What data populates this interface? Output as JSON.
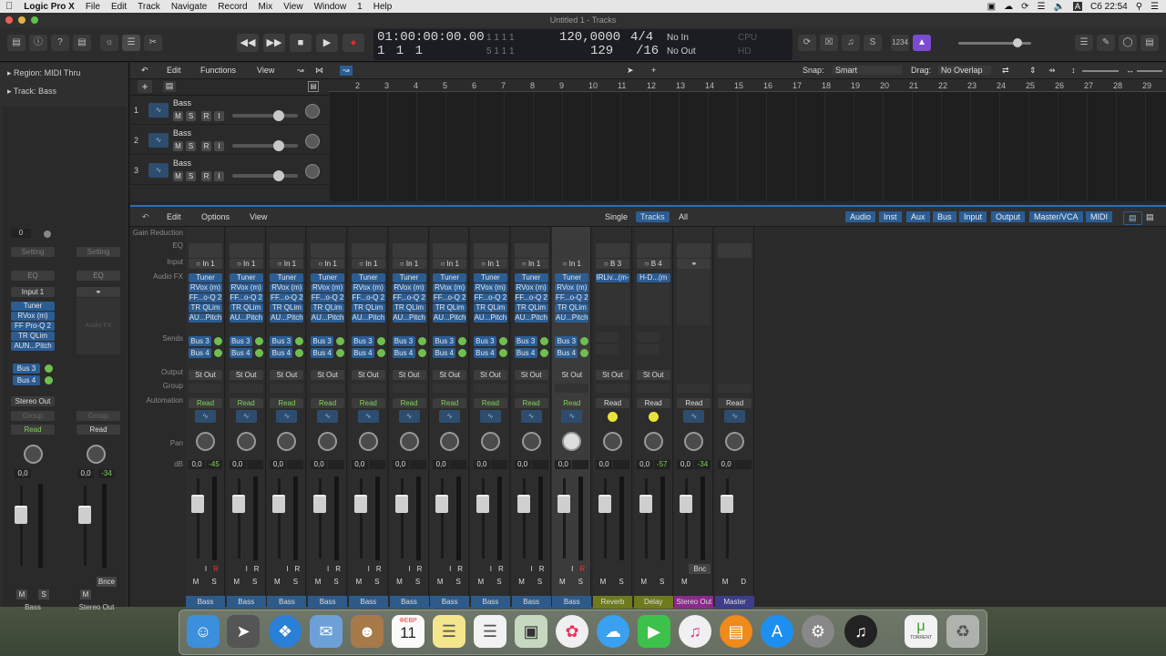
{
  "menubar": {
    "apple": "",
    "app": "Logic Pro X",
    "items": [
      "File",
      "Edit",
      "Track",
      "Navigate",
      "Record",
      "Mix",
      "View",
      "Window",
      "1",
      "Help"
    ],
    "time": "Сб 22:54",
    "input_lang": "A"
  },
  "window": {
    "title": "Untitled 1 - Tracks"
  },
  "lcd": {
    "time": "01:00:00:00.00",
    "bars": "1 1 1 1",
    "bars_small": "1 1 1 1",
    "bars_sub": "1 1 1",
    "bars_sub2": "5 1 1 1",
    "tempo": "120,0000",
    "tempo_sub": "129",
    "sig": "4/4",
    "div": "/16",
    "in": "No In",
    "out": "No Out"
  },
  "inspector": {
    "region_label": "Region:",
    "region_value": "MIDI Thru",
    "track_label": "Track:",
    "track_value": "Bass",
    "setting": "Setting",
    "eq": "EQ",
    "input": "Input 1",
    "audio_fx": "Audio FX",
    "plugins": [
      "Tuner",
      "RVox (m)",
      "FF Pro-Q 2",
      "TR QLim",
      "AUN...Pitch"
    ],
    "sends": [
      "Bus 3",
      "Bus 4"
    ],
    "output": "Stereo Out",
    "group": "Group",
    "read": "Read",
    "vol1": "0,0",
    "vol2": "0,0",
    "peak2": "-34",
    "bnce": "Bnce",
    "m": "M",
    "s": "S",
    "name1": "Bass",
    "name2": "Stereo Out",
    "top_value": "0"
  },
  "tracks_header": {
    "edit": "Edit",
    "functions": "Functions",
    "view": "View",
    "snap_label": "Snap:",
    "snap_value": "Smart",
    "drag_label": "Drag:",
    "drag_value": "No Overlap"
  },
  "tracks": [
    {
      "num": "1",
      "name": "Bass"
    },
    {
      "num": "2",
      "name": "Bass"
    },
    {
      "num": "3",
      "name": "Bass"
    }
  ],
  "track_buttons": {
    "m": "M",
    "s": "S",
    "r": "R",
    "i": "I"
  },
  "ruler": [
    "2",
    "3",
    "4",
    "5",
    "6",
    "7",
    "8",
    "9",
    "10",
    "11",
    "12",
    "13",
    "14",
    "15",
    "16",
    "17",
    "18",
    "19",
    "20",
    "21",
    "22",
    "23",
    "24",
    "25",
    "26",
    "27",
    "28",
    "29"
  ],
  "mixer_header": {
    "edit": "Edit",
    "options": "Options",
    "view": "View",
    "views": [
      "Single",
      "Tracks",
      "All"
    ],
    "filters": [
      "Audio",
      "Inst",
      "Aux",
      "Bus",
      "Input",
      "Output",
      "Master/VCA",
      "MIDI"
    ]
  },
  "mixer_rows": {
    "gain": "Gain Reduction",
    "eq": "EQ",
    "input": "Input",
    "audio_fx": "Audio FX",
    "sends": "Sends",
    "output": "Output",
    "group": "Group",
    "automation": "Automation",
    "pan": "Pan",
    "db": "dB"
  },
  "mixer_strips": [
    {
      "name": "Bass",
      "input": "In 1",
      "fx": [
        "Tuner",
        "RVox (m)",
        "FF...o-Q 2",
        "TR QLim",
        "AU...Pitch"
      ],
      "sends": [
        "Bus 3",
        "Bus 4"
      ],
      "out": "St Out",
      "auto": "Read",
      "vol": "0,0",
      "peak": "-45",
      "color": "#2e5a8a",
      "rec": "true"
    },
    {
      "name": "Bass",
      "input": "In 1",
      "fx": [
        "Tuner",
        "RVox (m)",
        "FF...o-Q 2",
        "TR QLim",
        "AU...Pitch"
      ],
      "sends": [
        "Bus 3",
        "Bus 4"
      ],
      "out": "St Out",
      "auto": "Read",
      "vol": "0,0",
      "peak": "",
      "color": "#2e5a8a",
      "rec": "true"
    },
    {
      "name": "Bass",
      "input": "In 1",
      "fx": [
        "Tuner",
        "RVox (m)",
        "FF...o-Q 2",
        "TR QLim",
        "AU...Pitch"
      ],
      "sends": [
        "Bus 3",
        "Bus 4"
      ],
      "out": "St Out",
      "auto": "Read",
      "vol": "0,0",
      "peak": "",
      "color": "#2e5a8a",
      "rec": "true"
    },
    {
      "name": "Bass",
      "input": "In 1",
      "fx": [
        "Tuner",
        "RVox (m)",
        "FF...o-Q 2",
        "TR QLim",
        "AU...Pitch"
      ],
      "sends": [
        "Bus 3",
        "Bus 4"
      ],
      "out": "St Out",
      "auto": "Read",
      "vol": "0,0",
      "peak": "",
      "color": "#2e5a8a",
      "rec": "true"
    },
    {
      "name": "Bass",
      "input": "In 1",
      "fx": [
        "Tuner",
        "RVox (m)",
        "FF...o-Q 2",
        "TR QLim",
        "AU...Pitch"
      ],
      "sends": [
        "Bus 3",
        "Bus 4"
      ],
      "out": "St Out",
      "auto": "Read",
      "vol": "0,0",
      "peak": "",
      "color": "#2e5a8a",
      "rec": "true"
    },
    {
      "name": "Bass",
      "input": "In 1",
      "fx": [
        "Tuner",
        "RVox (m)",
        "FF...o-Q 2",
        "TR QLim",
        "AU...Pitch"
      ],
      "sends": [
        "Bus 3",
        "Bus 4"
      ],
      "out": "St Out",
      "auto": "Read",
      "vol": "0,0",
      "peak": "",
      "color": "#2e5a8a",
      "rec": "true"
    },
    {
      "name": "Bass",
      "input": "In 1",
      "fx": [
        "Tuner",
        "RVox (m)",
        "FF...o-Q 2",
        "TR QLim",
        "AU...Pitch"
      ],
      "sends": [
        "Bus 3",
        "Bus 4"
      ],
      "out": "St Out",
      "auto": "Read",
      "vol": "0,0",
      "peak": "",
      "color": "#2e5a8a",
      "rec": "true"
    },
    {
      "name": "Bass",
      "input": "In 1",
      "fx": [
        "Tuner",
        "RVox (m)",
        "FF...o-Q 2",
        "TR QLim",
        "AU...Pitch"
      ],
      "sends": [
        "Bus 3",
        "Bus 4"
      ],
      "out": "St Out",
      "auto": "Read",
      "vol": "0,0",
      "peak": "",
      "color": "#2e5a8a",
      "rec": "true"
    },
    {
      "name": "Bass",
      "input": "In 1",
      "fx": [
        "Tuner",
        "RVox (m)",
        "FF...o-Q 2",
        "TR QLim",
        "AU...Pitch"
      ],
      "sends": [
        "Bus 3",
        "Bus 4"
      ],
      "out": "St Out",
      "auto": "Read",
      "vol": "0,0",
      "peak": "",
      "color": "#2e5a8a",
      "rec": "true"
    },
    {
      "name": "Bass",
      "input": "In 1",
      "fx": [
        "Tuner",
        "RVox (m)",
        "FF...o-Q 2",
        "TR QLim",
        "AU...Pitch"
      ],
      "sends": [
        "Bus 3",
        "Bus 4"
      ],
      "out": "St Out",
      "auto": "Read",
      "vol": "0,0",
      "peak": "",
      "color": "#2e5a8a",
      "rec": "true",
      "selected": "true"
    },
    {
      "name": "Reverb",
      "input": "B 3",
      "fx": [
        "IRLiv...(m-"
      ],
      "sends": [],
      "out": "St Out",
      "auto": "Read",
      "vol": "0,0",
      "peak": "",
      "color": "#6d7a1e",
      "rec": "false",
      "aux": "true"
    },
    {
      "name": "Delay",
      "input": "B 4",
      "fx": [
        "H-D...(m"
      ],
      "sends": [],
      "out": "St Out",
      "auto": "Read",
      "vol": "0,0",
      "peak": "-57",
      "color": "#6d7a1e",
      "rec": "false",
      "aux": "true"
    },
    {
      "name": "Stereo Out",
      "input": "",
      "fx": [],
      "sends": [],
      "out": "",
      "auto": "Read",
      "vol": "0,0",
      "peak": "-34",
      "color": "#8a2a8a",
      "rec": "false",
      "bnc": "Bnc"
    },
    {
      "name": "Master",
      "input": "",
      "fx": [],
      "sends": [],
      "out": "",
      "auto": "Read",
      "vol": "0,0",
      "peak": "",
      "color": "#3d3d8a",
      "rec": "false",
      "master": "true"
    }
  ],
  "strip_buttons": {
    "m": "M",
    "s": "S",
    "i": "I",
    "r": "R",
    "d": "D"
  },
  "dock": [
    "Finder",
    "Launchpad",
    "Safari",
    "Mail",
    "Contacts",
    "Calendar",
    "Notes",
    "Reminders",
    "Preview",
    "Photos",
    "Messages",
    "FaceTime",
    "iTunes",
    "iBooks",
    "App Store",
    "System Preferences",
    "Logic Pro X",
    "Torrent",
    "Trash"
  ],
  "calendar_month": "ФЕВР",
  "calendar_day": "11",
  "torrent_label": "TORRENT"
}
